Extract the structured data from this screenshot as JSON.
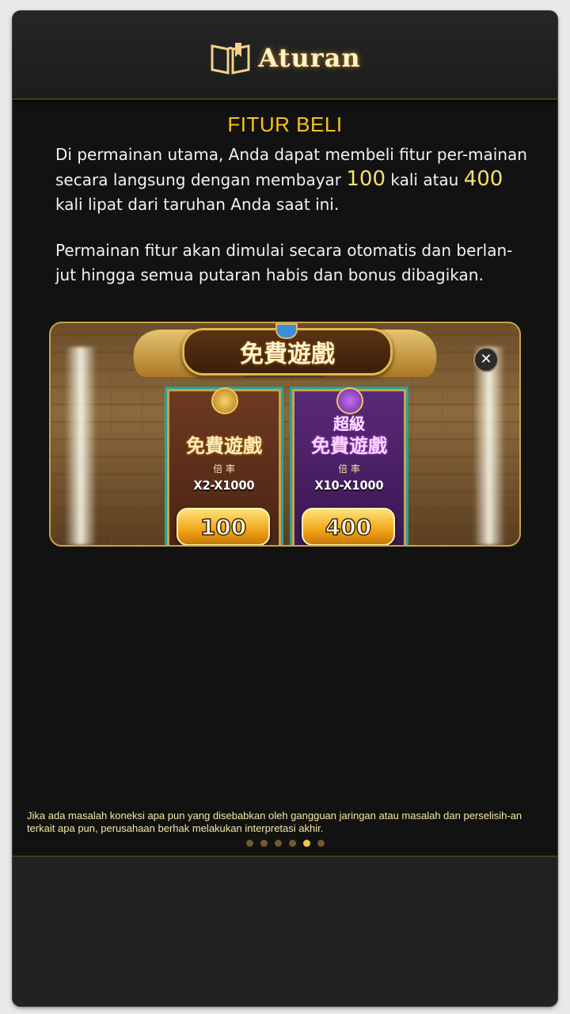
{
  "header": {
    "title": "Aturan",
    "icon": "open-book-icon"
  },
  "section": {
    "title": "FITUR BELI",
    "p1_before": "Di permainan utama, Anda dapat membeli fitur per-mainan secara langsung dengan membayar ",
    "p1_hl1": "100",
    "p1_mid": " kali atau ",
    "p1_hl2": "400",
    "p1_after": " kali lipat dari taruhan Anda saat ini.",
    "p2": "Permainan fitur akan dimulai secara otomatis dan berlan-jut hingga semua putaran habis dan bonus dibagikan."
  },
  "banner": {
    "title": "免費遊戲",
    "close_icon": "close-icon",
    "cards": [
      {
        "super": "",
        "title": "免費遊戲",
        "label": "倍 率",
        "multiplier": "X2-X1000",
        "price": "100",
        "emblem": "scarab-icon"
      },
      {
        "super": "超級",
        "title": "免費遊戲",
        "label": "倍 率",
        "multiplier": "X10-X1000",
        "price": "400",
        "emblem": "scarab-icon"
      }
    ]
  },
  "footer": {
    "note": "Jika ada masalah koneksi apa pun yang disebabkan oleh gangguan jaringan atau masalah dan perselisih-an terkait apa pun, perusahaan berhak melakukan interpretasi akhir.",
    "pages_total": 6,
    "page_active": 5
  },
  "colors": {
    "accent": "#f7c21c",
    "highlight": "#f7e06a",
    "panel": "#121212"
  }
}
